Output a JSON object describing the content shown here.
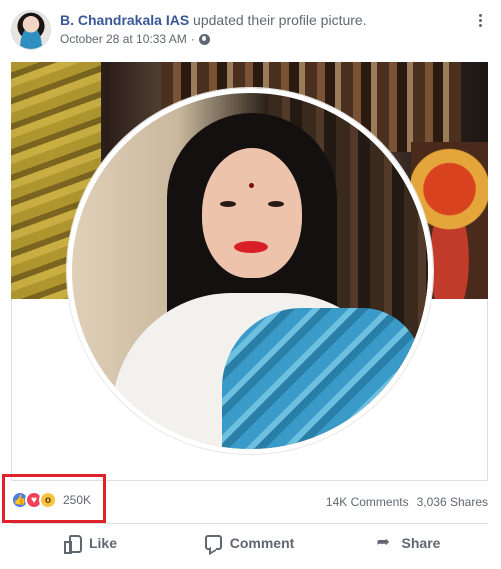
{
  "post": {
    "author_name": "B. Chandrakala IAS",
    "action_text": " updated their profile picture.",
    "timestamp": "October 28 at 10:33 AM",
    "timestamp_separator": "·",
    "privacy_icon": "globe-icon",
    "menu_icon": "more-options-icon"
  },
  "reactions": {
    "types": [
      "like",
      "love",
      "wow"
    ],
    "count": "250K",
    "comments": "14K Comments",
    "shares": "3,036 Shares",
    "highlight_color": "#e0202a"
  },
  "actions": {
    "like_label": "Like",
    "comment_label": "Comment",
    "share_label": "Share"
  },
  "colors": {
    "author_link": "#385898",
    "secondary_text": "#616770",
    "like_blue": "#4a7fe8",
    "love_red": "#f0425b",
    "wow_yellow": "#f7c442"
  }
}
